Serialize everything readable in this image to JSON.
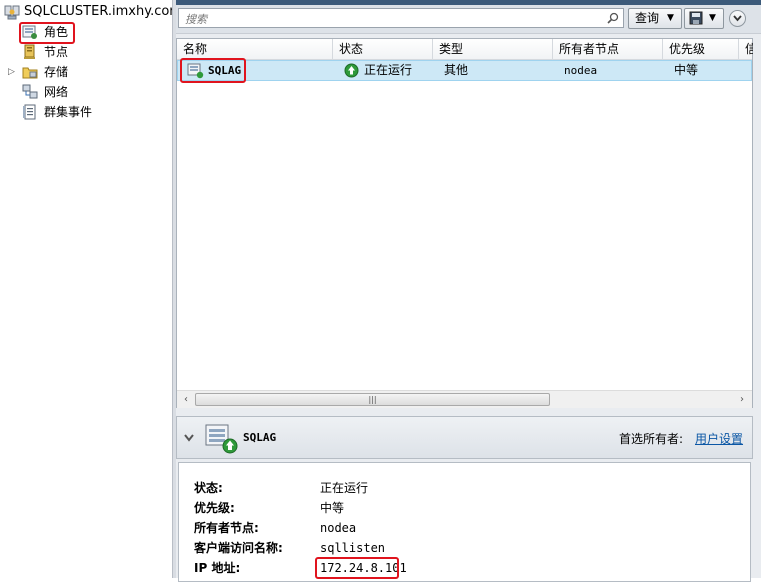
{
  "tree": {
    "root": "SQLCLUSTER.imxhy.com",
    "items": [
      {
        "label": "角色",
        "icon": "roles-icon"
      },
      {
        "label": "节点",
        "icon": "nodes-icon"
      },
      {
        "label": "存储",
        "icon": "storage-icon"
      },
      {
        "label": "网络",
        "icon": "network-icon"
      },
      {
        "label": "群集事件",
        "icon": "cluster-events-icon"
      }
    ]
  },
  "toolbar": {
    "search_placeholder": "搜索",
    "query_label": "查询"
  },
  "grid": {
    "columns": [
      "名称",
      "状态",
      "类型",
      "所有者节点",
      "优先级",
      "信"
    ],
    "rows": [
      {
        "name": "SQLAG",
        "status": "正在运行",
        "type": "其他",
        "owner": "nodea",
        "priority": "中等"
      }
    ]
  },
  "detail": {
    "title": "SQLAG",
    "preferred_owner_label": "首选所有者:",
    "preferred_owner_link": "用户设置",
    "properties": [
      {
        "key": "状态:",
        "value": "正在运行"
      },
      {
        "key": "优先级:",
        "value": "中等"
      },
      {
        "key": "所有者节点:",
        "value": "nodea"
      },
      {
        "key": "客户端访问名称:",
        "value": "sqllisten"
      },
      {
        "key": "IP 地址:",
        "value": "172.24.8.101"
      }
    ]
  },
  "colors": {
    "highlight": "#e0141e",
    "selected_row": "#cde8f6",
    "link": "#0b57a5",
    "running_green": "#2e9a3a"
  }
}
